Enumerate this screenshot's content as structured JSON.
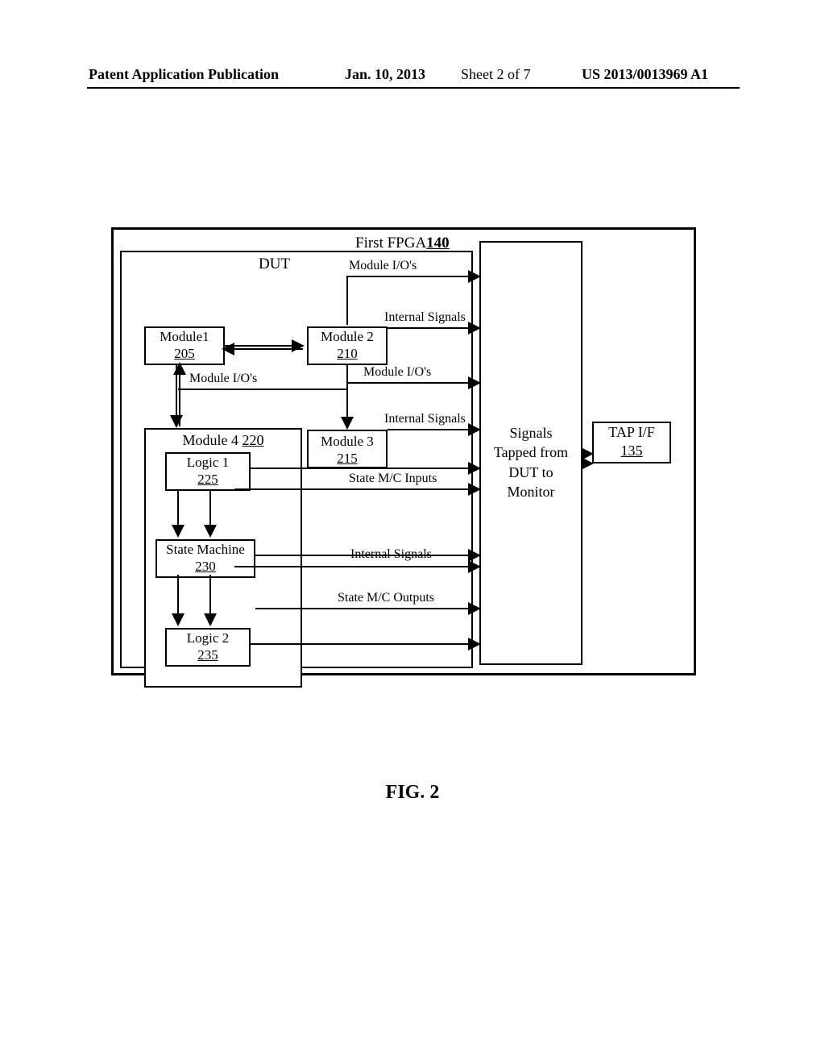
{
  "header": {
    "pub_type": "Patent Application Publication",
    "date": "Jan. 10, 2013",
    "sheet": "Sheet 2 of 7",
    "docnum": "US 2013/0013969 A1"
  },
  "figure": {
    "caption": "FIG. 2",
    "first_fpga_label": "First FPGA",
    "first_fpga_num": "140",
    "dut_label": "DUT",
    "module1_label": "Module1",
    "module1_num": "205",
    "module2_label": "Module 2",
    "module2_num": "210",
    "module3_label": "Module 3",
    "module3_num": "215",
    "module4_label": "Module 4",
    "module4_num": "220",
    "logic1_label": "Logic 1",
    "logic1_num": "225",
    "statem_label": "State Machine",
    "statem_num": "230",
    "logic2_label": "Logic 2",
    "logic2_num": "235",
    "monitor_text1": "Signals",
    "monitor_text2": "Tapped from",
    "monitor_text3": "DUT to",
    "monitor_text4": "Monitor",
    "tap_label": "TAP I/F",
    "tap_num": "135",
    "sig_module_ios_top": "Module I/O's",
    "sig_internal_signals_m2": "Internal Signals",
    "sig_module_ios_mid": "Module I/O's",
    "sig_module_ios_m3": "Module I/O's",
    "sig_internal_signals_m3": "Internal Signals",
    "sig_state_inputs": "State M/C Inputs",
    "sig_internal_signals_sm": "Internal Signals",
    "sig_state_outputs": "State M/C Outputs"
  }
}
